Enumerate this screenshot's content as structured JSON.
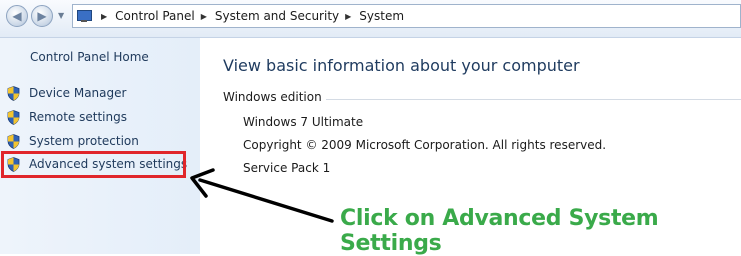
{
  "window": {
    "breadcrumb": [
      "Control Panel",
      "System and Security",
      "System"
    ]
  },
  "sidebar": {
    "home_label": "Control Panel Home",
    "tasks": [
      {
        "label": "Device Manager",
        "icon": "uac-shield-icon"
      },
      {
        "label": "Remote settings",
        "icon": "uac-shield-icon"
      },
      {
        "label": "System protection",
        "icon": "uac-shield-icon"
      },
      {
        "label": "Advanced system settings",
        "icon": "uac-shield-icon",
        "highlighted": true
      }
    ]
  },
  "main": {
    "title": "View basic information about your computer",
    "section": "Windows edition",
    "edition": "Windows 7 Ultimate",
    "copyright": "Copyright © 2009 Microsoft Corporation.  All rights reserved.",
    "service_pack": "Service Pack 1"
  },
  "annotation": {
    "text": "Click on Advanced System Settings",
    "text_color": "#3aaa4a",
    "highlight_color": "#e0262b",
    "arrow_color": "#000000"
  }
}
